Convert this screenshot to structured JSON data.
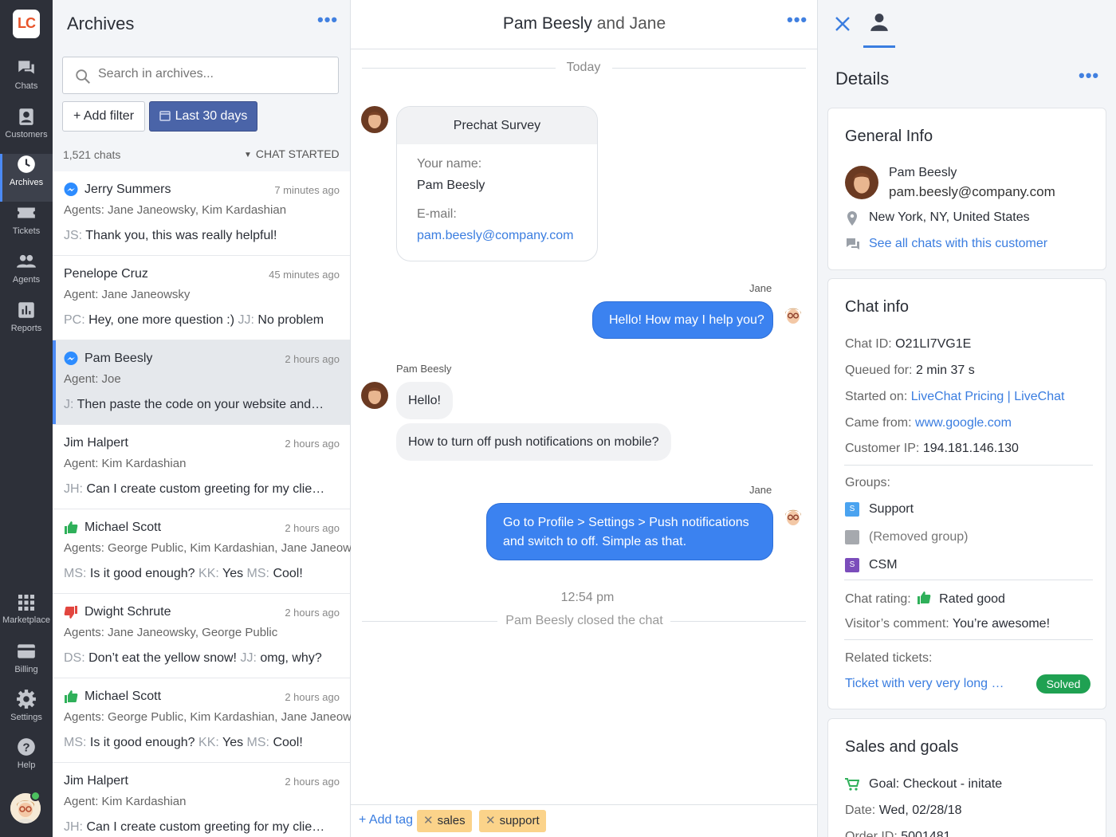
{
  "rail": {
    "logo": "LC",
    "items": [
      {
        "label": "Chats",
        "icon": "chats-icon"
      },
      {
        "label": "Customers",
        "icon": "customers-icon"
      },
      {
        "label": "Archives",
        "icon": "archives-icon"
      },
      {
        "label": "Tickets",
        "icon": "tickets-icon"
      },
      {
        "label": "Agents",
        "icon": "agents-icon"
      },
      {
        "label": "Reports",
        "icon": "reports-icon"
      },
      {
        "label": "Marketplace",
        "icon": "marketplace-icon"
      },
      {
        "label": "Billing",
        "icon": "billing-icon"
      },
      {
        "label": "Settings",
        "icon": "settings-icon"
      },
      {
        "label": "Help",
        "icon": "help-icon"
      }
    ]
  },
  "archives": {
    "title": "Archives",
    "menu": "•••",
    "search_placeholder": "Search in archives...",
    "add_filter": "+ Add filter",
    "date_filter": "Last 30 days",
    "count": "1,521 chats",
    "sort": "CHAT STARTED",
    "items": [
      {
        "name": "Jerry Summers",
        "time": "7 minutes ago",
        "agents": "Agents: Jane Janeowsky, Kim Kardashian",
        "msg": [
          [
            "JS:",
            "Thank you, this was really helpful!"
          ]
        ],
        "icon": "messenger"
      },
      {
        "name": "Penelope Cruz",
        "time": "45 minutes ago",
        "agents": "Agent: Jane Janeowsky",
        "msg": [
          [
            "PC:",
            "Hey, one more question :)"
          ],
          [
            "JJ:",
            "No problem"
          ]
        ],
        "icon": ""
      },
      {
        "name": "Pam Beesly",
        "time": "2 hours ago",
        "agents": "Agent: Joe",
        "msg": [
          [
            "J:",
            "Then paste the code on your website and enjoy"
          ]
        ],
        "icon": "messenger"
      },
      {
        "name": "Jim Halpert",
        "time": "2 hours ago",
        "agents": "Agent: Kim Kardashian",
        "msg": [
          [
            "JH:",
            "Can I create custom greeting for my clients?"
          ]
        ],
        "icon": ""
      },
      {
        "name": "Michael Scott",
        "time": "2 hours ago",
        "agents": "Agents: George Public, Kim Kardashian, Jane Janeowsky",
        "msg": [
          [
            "MS:",
            "Is it good enough?"
          ],
          [
            "KK:",
            "Yes"
          ],
          [
            "MS:",
            "Cool!"
          ]
        ],
        "icon": "thumb-up"
      },
      {
        "name": "Dwight Schrute",
        "time": "2 hours ago",
        "agents": "Agents: Jane Janeowsky, George Public",
        "msg": [
          [
            "DS:",
            "Don’t eat the yellow snow!"
          ],
          [
            "JJ:",
            "omg, why?"
          ]
        ],
        "icon": "thumb-down"
      },
      {
        "name": "Michael Scott",
        "time": "2 hours ago",
        "agents": "Agents: George Public, Kim Kardashian, Jane Janeowsky",
        "msg": [
          [
            "MS:",
            "Is it good enough?"
          ],
          [
            "KK:",
            "Yes"
          ],
          [
            "MS:",
            "Cool!"
          ]
        ],
        "icon": "thumb-up"
      },
      {
        "name": "Jim Halpert",
        "time": "2 hours ago",
        "agents": "Agent: Kim Kardashian",
        "msg": [
          [
            "JH:",
            "Can I create custom greeting for my clients?"
          ]
        ],
        "icon": ""
      }
    ]
  },
  "chat": {
    "title_name": "Pam Beesly",
    "title_rest": " and Jane",
    "menu": "•••",
    "day": "Today",
    "survey": {
      "title": "Prechat Survey",
      "name_label": "Your name:",
      "name_value": "Pam Beesly",
      "email_label": "E-mail:",
      "email_value": "pam.beesly@company.com"
    },
    "jane": "Jane",
    "pam": "Pam Beesly",
    "m1": "Hello! How may I help you?",
    "m2": "Hello!",
    "m3": "How to turn off push notifications on mobile?",
    "m4a": "Go to Profile > Settings > Push notifications",
    "m4b": "and switch to off. Simple as that.",
    "time": "12:54 pm",
    "closed": "Pam Beesly closed the chat",
    "add_tag": "+ Add tag",
    "tags": [
      "sales",
      "support"
    ]
  },
  "details": {
    "title": "Details",
    "menu": "•••",
    "general": {
      "title": "General Info",
      "name": "Pam Beesly",
      "email": "pam.beesly@company.com",
      "location": "New York, NY, United States",
      "all_chats": "See all chats with this customer"
    },
    "chatinfo": {
      "title": "Chat info",
      "id_l": "Chat ID:",
      "id": "O21LI7VG1E",
      "q_l": "Queued for:",
      "q": "2 min 37 s",
      "s_l": "Started on:",
      "s": "LiveChat Pricing | LiveChat",
      "c_l": "Came from:",
      "c": "www.google.com",
      "ip_l": "Customer IP:",
      "ip": "194.181.146.130",
      "groups_l": "Groups:",
      "groups": [
        {
          "name": "Support",
          "letter": "S",
          "color": "#4aa3f0"
        },
        {
          "name": "(Removed group)",
          "letter": "",
          "color": "#a6a9ae"
        },
        {
          "name": "CSM",
          "letter": "S",
          "color": "#7b4dbb"
        }
      ],
      "rating_l": "Chat rating:",
      "rating": "Rated good",
      "comment_l": "Visitor’s comment:",
      "comment": "You’re awesome!",
      "tickets_l": "Related tickets:",
      "ticket": "Ticket with very very long name",
      "ticket_status": "Solved"
    },
    "sales": {
      "title": "Sales and goals",
      "goal": "Goal: Checkout - initate",
      "date_l": "Date:",
      "date": "Wed, 02/28/18",
      "order_l": "Order ID:",
      "order": "5001481"
    }
  }
}
